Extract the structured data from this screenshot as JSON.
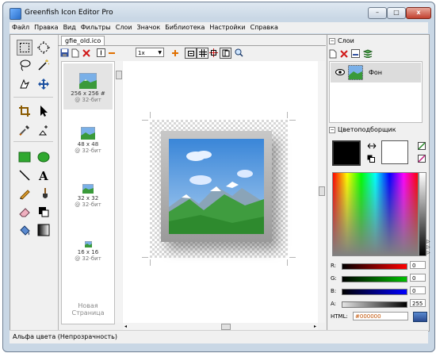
{
  "window": {
    "title": "Greenfish Icon Editor Pro",
    "controls": {
      "minimize": "–",
      "maximize": "□",
      "close": "x"
    }
  },
  "menu": [
    "Файл",
    "Правка",
    "Вид",
    "Фильтры",
    "Слои",
    "Значок",
    "Библиотека",
    "Настройки",
    "Справка"
  ],
  "tools": [
    "rect-select",
    "ellipse-select",
    "lasso",
    "magic-wand",
    "pointer-hand",
    "move",
    "crop",
    "cursor",
    "eyedropper",
    "color-replace",
    "rectangle",
    "ellipse",
    "line",
    "text",
    "pencil",
    "brush",
    "eraser",
    "fill",
    "bucket",
    "gradient"
  ],
  "document": {
    "tab_label": "gfie_old.ico",
    "zoom": "1x",
    "pages": [
      {
        "size": "256 x 256 #",
        "depth": "@ 32-бит"
      },
      {
        "size": "48 x 48",
        "depth": "@ 32-бит"
      },
      {
        "size": "32 x 32",
        "depth": "@ 32-бит"
      },
      {
        "size": "16 x 16",
        "depth": "@ 32-бит"
      }
    ],
    "new_page_label": "Новая Страница"
  },
  "layers": {
    "title": "Слои",
    "items": [
      {
        "name": "Фон"
      }
    ]
  },
  "color_picker": {
    "title": "Цветоподборщик",
    "primary_color": "#000000",
    "secondary_color": "#ffffff",
    "channels": [
      {
        "label": "R:",
        "value": "0",
        "color": "#ff0000"
      },
      {
        "label": "G:",
        "value": "0",
        "color": "#00c000"
      },
      {
        "label": "B:",
        "value": "0",
        "color": "#0000ff"
      },
      {
        "label": "A:",
        "value": "255",
        "color": "#000000"
      }
    ],
    "html_label": "HTML:",
    "html_value": "#000000"
  },
  "status_text": "Альфа цвета (Непрозрачность)"
}
